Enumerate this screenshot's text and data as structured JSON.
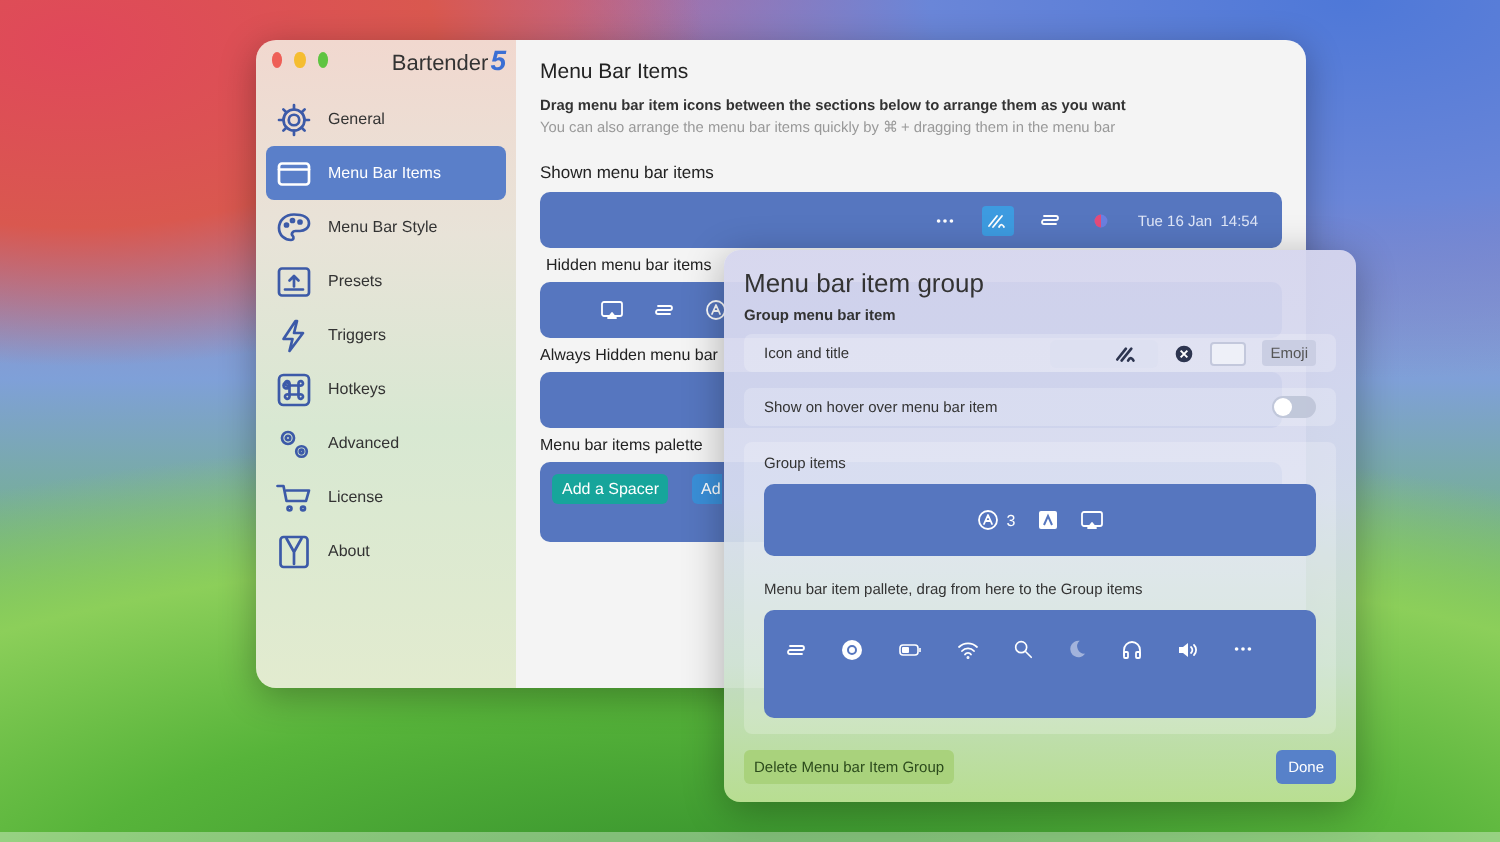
{
  "app": {
    "name": "Bartender",
    "version": "5"
  },
  "sidebar": {
    "items": [
      {
        "label": "General",
        "selected": false
      },
      {
        "label": "Menu Bar Items",
        "selected": true
      },
      {
        "label": "Menu Bar Style",
        "selected": false
      },
      {
        "label": "Presets",
        "selected": false
      },
      {
        "label": "Triggers",
        "selected": false
      },
      {
        "label": "Hotkeys",
        "selected": false
      },
      {
        "label": "Advanced",
        "selected": false
      },
      {
        "label": "License",
        "selected": false
      },
      {
        "label": "About",
        "selected": false
      }
    ]
  },
  "content": {
    "title": "Menu Bar Items",
    "instruction": "Drag menu bar item icons between the sections below to arrange them as you want",
    "hint": "You can also arrange the menu bar items quickly by ⌘ + dragging them in the menu bar",
    "shown": {
      "heading": "Shown menu bar items",
      "items": [
        {
          "kind": "ellipsis",
          "selected": false
        },
        {
          "kind": "signature",
          "selected": true
        },
        {
          "kind": "stack",
          "selected": false
        },
        {
          "kind": "orb",
          "selected": false
        }
      ],
      "clock": "Tue 16 Jan  14:54"
    },
    "hidden": {
      "heading": "Hidden menu bar items"
    },
    "always_hidden": {
      "heading": "Always Hidden menu bar"
    },
    "palette": {
      "heading": "Menu bar items palette",
      "buttons": [
        {
          "label": "Add a Spacer",
          "color": "#17a59b"
        },
        {
          "label": "Ad",
          "color": "#3a8fd8"
        }
      ]
    }
  },
  "group_sheet": {
    "title": "Menu bar item group",
    "subtitle": "Group menu bar item",
    "icon_row": {
      "label": "Icon and title",
      "emoji_button": "Emoji"
    },
    "hover_toggle": {
      "label": "Show on hover over menu bar item",
      "on": false
    },
    "group_items": {
      "heading": "Group items",
      "count": "3"
    },
    "palette_caption": "Menu bar item pallete, drag from here to the Group items",
    "buttons": {
      "delete": "Delete Menu bar Item Group",
      "done": "Done"
    }
  }
}
